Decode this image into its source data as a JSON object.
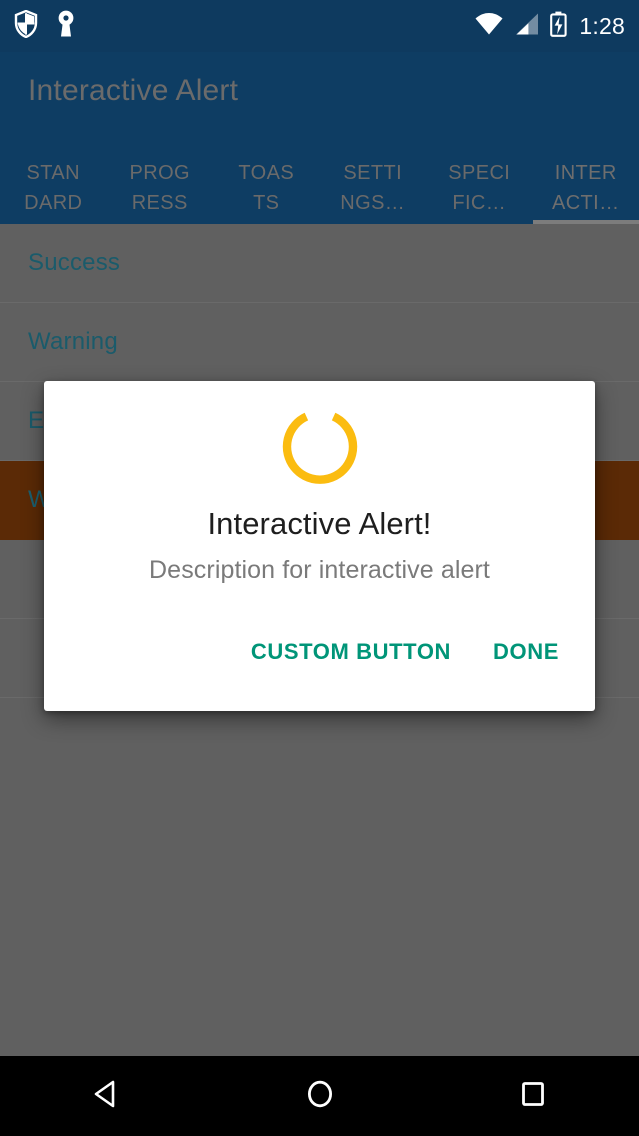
{
  "status_bar": {
    "icons": [
      "shield-icon",
      "vpn-key-icon",
      "wifi-icon",
      "cell-signal-icon",
      "battery-charging-icon"
    ],
    "time": "1:28",
    "background_color": "#0E3A5F"
  },
  "app_bar": {
    "title": "Interactive Alert",
    "background_color": "#0E3D63",
    "title_color": "#6B6B6B"
  },
  "tabs": {
    "active_index": 5,
    "indicator_color": "#7C7C7C",
    "items": [
      {
        "line1": "STAN",
        "line2": "DARD",
        "full": "STANDARD"
      },
      {
        "line1": "PROG",
        "line2": "RESS",
        "full": "PROGRESS"
      },
      {
        "line1": "TOAS",
        "line2": "TS",
        "full": "TOASTS"
      },
      {
        "line1": "SETTI",
        "line2": "NGS…",
        "full": "SETTINGS…"
      },
      {
        "line1": "SPECI",
        "line2": "FIC…",
        "full": "SPECIFIC…"
      },
      {
        "line1": "INTER",
        "line2": "ACTI…",
        "full": "INTERACTI…"
      }
    ]
  },
  "list": {
    "scrim_color": "#606060",
    "rows": [
      {
        "label": "Success",
        "highlighted": false
      },
      {
        "label": "Warning",
        "highlighted": false
      },
      {
        "label": "E",
        "highlighted": false
      },
      {
        "label": "W",
        "highlighted": true
      },
      {
        "label": "",
        "highlighted": false
      },
      {
        "label": "",
        "highlighted": false
      }
    ]
  },
  "dialog": {
    "title": "Interactive Alert!",
    "description": "Description for interactive alert",
    "icon": "circular-progress-spinner-icon",
    "spinner_color": "#FBBC10",
    "accent_color": "#009578",
    "buttons": [
      {
        "label": "CUSTOM BUTTON",
        "name": "custom-button"
      },
      {
        "label": "DONE",
        "name": "done-button"
      }
    ]
  },
  "nav_bar": {
    "background_color": "#000000",
    "buttons": [
      {
        "name": "back-button",
        "icon": "back-triangle-icon"
      },
      {
        "name": "home-button",
        "icon": "home-circle-icon"
      },
      {
        "name": "recents-button",
        "icon": "recents-square-icon"
      }
    ]
  }
}
